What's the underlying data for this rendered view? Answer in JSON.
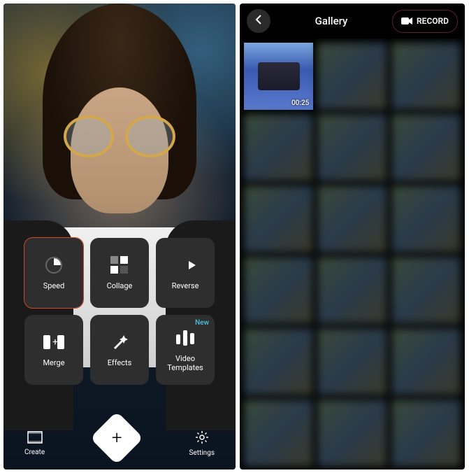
{
  "left": {
    "tools": [
      {
        "id": "speed",
        "label": "Speed",
        "icon": "speed-icon",
        "selected": true
      },
      {
        "id": "collage",
        "label": "Collage",
        "icon": "collage-icon"
      },
      {
        "id": "reverse",
        "label": "Reverse",
        "icon": "reverse-icon"
      },
      {
        "id": "merge",
        "label": "Merge",
        "icon": "merge-icon"
      },
      {
        "id": "effects",
        "label": "Effects",
        "icon": "effects-icon"
      },
      {
        "id": "video-templates",
        "label": "Video\nTemplates",
        "icon": "video-templates-icon",
        "badge": "New"
      }
    ],
    "bottom": {
      "create_label": "Create",
      "settings_label": "Settings"
    }
  },
  "right": {
    "title": "Gallery",
    "record_label": "RECORD",
    "selected_item": {
      "duration": "00:25"
    }
  },
  "colors": {
    "accent_orange": "#d04a2a",
    "accent_teal": "#4ac0e0",
    "tile_bg": "#2e2e2e"
  }
}
